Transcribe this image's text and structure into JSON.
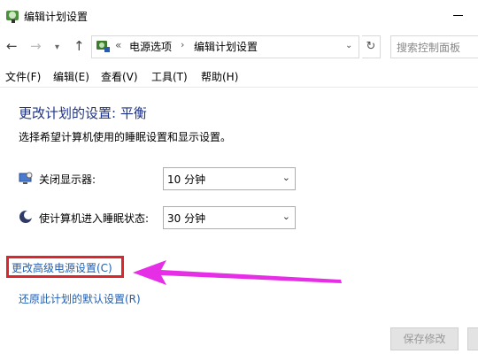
{
  "window": {
    "title": "编辑计划设置"
  },
  "address": {
    "prefix": "«",
    "breadcrumbs": [
      "电源选项",
      "编辑计划设置"
    ],
    "separator": "›",
    "search_placeholder": "搜索控制面板"
  },
  "menu": [
    "文件(F)",
    "编辑(E)",
    "查看(V)",
    "工具(T)",
    "帮助(H)"
  ],
  "main": {
    "title": "更改计划的设置: 平衡",
    "subtitle": "选择希望计算机使用的睡眠设置和显示设置。",
    "settings": [
      {
        "label": "关闭显示器:",
        "value": "10 分钟",
        "icon": "monitor-icon"
      },
      {
        "label": "使计算机进入睡眠状态:",
        "value": "30 分钟",
        "icon": "moon-sleep-icon"
      }
    ],
    "links": {
      "advanced": "更改高级电源设置(C)",
      "restore": "还原此计划的默认设置(R)"
    }
  },
  "buttons": {
    "save": "保存修改"
  },
  "colors": {
    "title_blue": "#1e3287",
    "link_blue": "#1e5fb4",
    "highlight_red": "#d9272d",
    "arrow_magenta": "#e62ee6"
  }
}
